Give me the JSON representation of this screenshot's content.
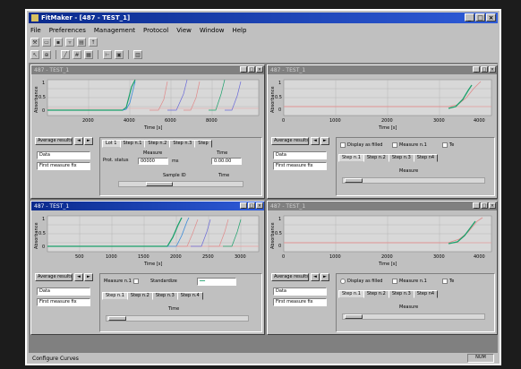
{
  "app": {
    "title": "FitMaker - [487 - TEST_1]"
  },
  "menu": [
    "File",
    "Preferences",
    "Management",
    "Protocol",
    "View",
    "Window",
    "Help"
  ],
  "status": {
    "text": "Configure Curves",
    "right": "NUM"
  },
  "colors": {
    "accent": "#2e5bd8",
    "green": "#1aa06a",
    "red": "#e08a8a",
    "blue": "#6a6ad8",
    "grid_red": "#e8a0a0"
  },
  "windows": [
    {
      "title": "487 - TEST_1",
      "ylabel": "Absorbance",
      "xlabel": "Time [s]",
      "xticks": [
        "2000",
        "4000",
        "6000",
        "8000"
      ],
      "yticks": [
        "1",
        "0.5",
        "0"
      ],
      "avg_btn": "Average results",
      "sel1": "Data",
      "sel2": "First measure fix",
      "tabs": [
        "Lot 1",
        "Step n.1",
        "Step n.2",
        "Step n.3",
        "Step"
      ],
      "field_label": "Prot. status",
      "measure_label": "Measure",
      "measure_value": "00000",
      "unit": "ms",
      "time_label": "Time",
      "time_value": "0:00:00",
      "row_label": "Sample ID"
    },
    {
      "title": "487 - TEST_1",
      "ylabel": "Absorbance",
      "xlabel": "Time [s]",
      "xticks": [
        "0",
        "1000",
        "2000",
        "3000",
        "4000"
      ],
      "yticks": [
        "1",
        "0.5",
        "0"
      ],
      "avg_btn": "Average results",
      "sel1": "Data",
      "sel2": "First measure fix",
      "checks": [
        "Display as filled",
        "Measure n.1",
        "Te"
      ],
      "tabs": [
        "Step n.1",
        "Step n.2",
        "Step n.3",
        "Step n4"
      ],
      "row_label": "Measure"
    },
    {
      "title": "487 - TEST_1",
      "ylabel": "Absorbance",
      "xlabel": "Time [s]",
      "xticks": [
        "500",
        "1000",
        "1500",
        "2000",
        "2500",
        "3000"
      ],
      "yticks": [
        "1",
        "0.5",
        "0"
      ],
      "avg_btn": "Average results",
      "sel1": "Data",
      "sel2": "First measure fix",
      "checks": [
        "Measure n.1",
        "Standardize"
      ],
      "tabs": [
        "Step n.1",
        "Step n.2",
        "Step n.3",
        "Step n.4"
      ],
      "row_label": "Time"
    },
    {
      "title": "487 - TEST_1",
      "ylabel": "Absorbance",
      "xlabel": "Time [s]",
      "xticks": [
        "0",
        "1000",
        "2000",
        "3000",
        "4000"
      ],
      "yticks": [
        "1",
        "0.5",
        "0"
      ],
      "avg_btn": "Average results",
      "sel1": "Data",
      "sel2": "First measure fix",
      "checks": [
        "Display as filled",
        "Measure n.1",
        "Te"
      ],
      "tabs": [
        "Step n.1",
        "Step n.2",
        "Step n.3",
        "Step n4"
      ],
      "row_label": "Measure"
    }
  ]
}
